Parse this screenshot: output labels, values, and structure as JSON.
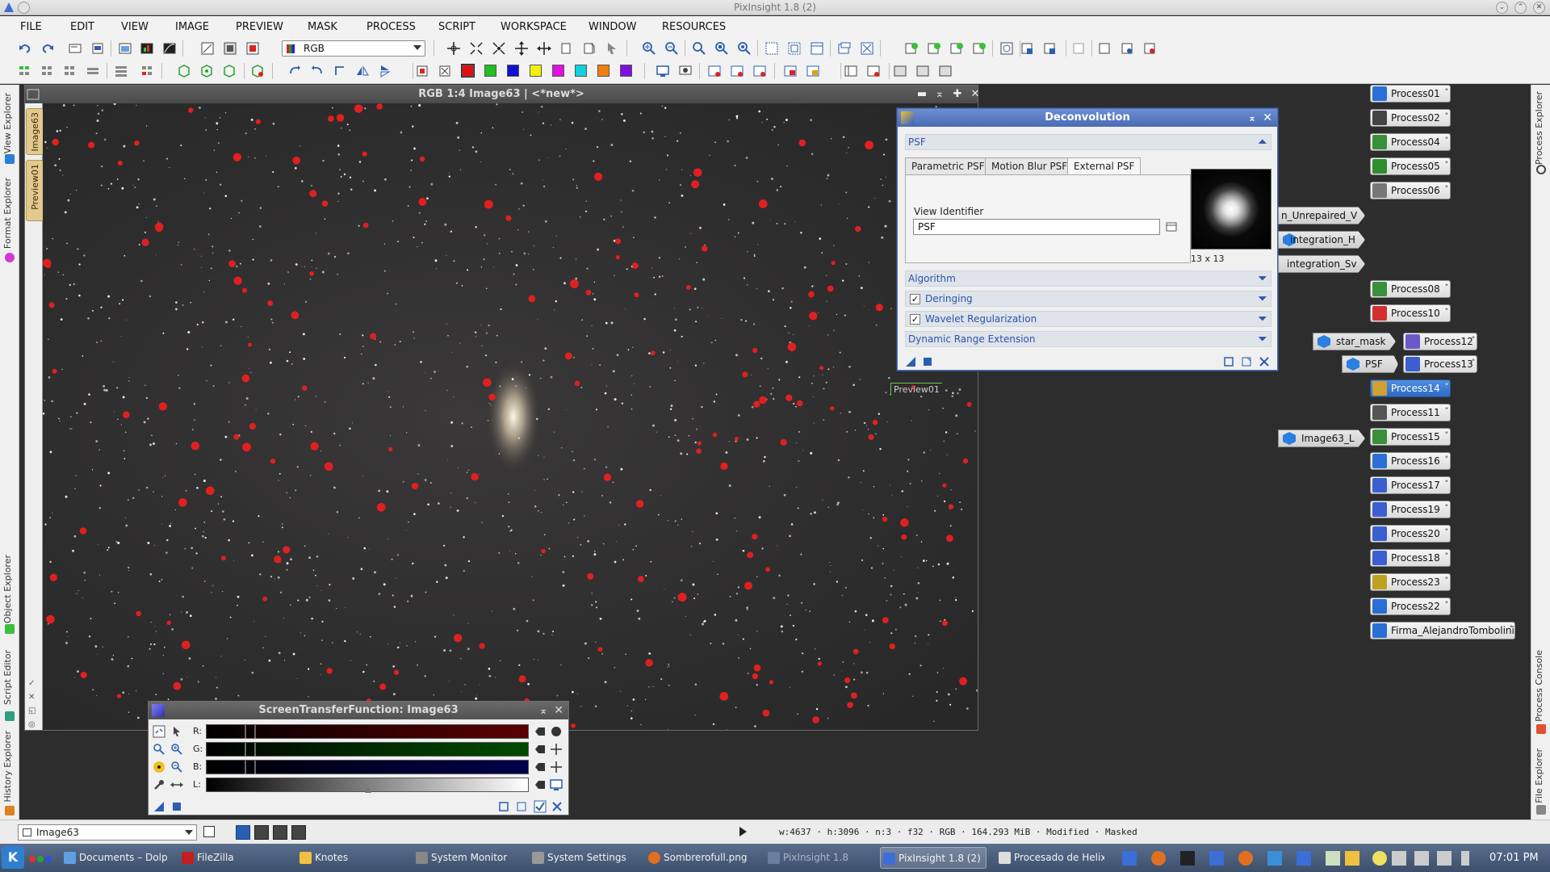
{
  "window": {
    "title": "PixInsight 1.8 (2)"
  },
  "menu": [
    "FILE",
    "EDIT",
    "VIEW",
    "IMAGE",
    "PREVIEW",
    "MASK",
    "PROCESS",
    "SCRIPT",
    "WORKSPACE",
    "WINDOW",
    "RESOURCES"
  ],
  "toolbar": {
    "color_mode": "RGB"
  },
  "left_panels": [
    "View Explorer",
    "Format Explorer",
    "Object Explorer",
    "Script Editor",
    "History Explorer"
  ],
  "right_panels": [
    "Process Explorer",
    "Process Console",
    "File Explorer"
  ],
  "image_tabs": [
    "Image63",
    "Preview01"
  ],
  "image_window": {
    "title": "RGB 1:4 Image63 | <*new*>",
    "preview_label": "Preview01"
  },
  "deconvolution": {
    "title": "Deconvolution",
    "psf_section": "PSF",
    "tabs": [
      "Parametric PSF",
      "Motion Blur PSF",
      "External PSF"
    ],
    "active_tab": "External PSF",
    "view_identifier_label": "View Identifier",
    "view_identifier_value": "PSF",
    "psf_size": "13 x 13",
    "sections": {
      "algorithm": "Algorithm",
      "deringing": "Deringing",
      "wavelet": "Wavelet Regularization",
      "dynamic_range": "Dynamic Range Extension"
    }
  },
  "process_icons": [
    {
      "label": "Process01",
      "color": "#2b6fd6"
    },
    {
      "label": "Process02",
      "color": "#444444"
    },
    {
      "label": "Process04",
      "color": "#3a8f3a"
    },
    {
      "label": "Process05",
      "color": "#2f8f2f"
    },
    {
      "label": "Process06",
      "color": "#777777"
    },
    {
      "label": "Process08",
      "color": "#3a8f3a"
    },
    {
      "label": "Process10",
      "color": "#d23030"
    },
    {
      "label": "Process12",
      "color": "#6a5ac9"
    },
    {
      "label": "Process13",
      "color": "#3b5fd0"
    },
    {
      "label": "Process14",
      "color": "#d0a030"
    },
    {
      "label": "Process11",
      "color": "#555555"
    },
    {
      "label": "Process15",
      "color": "#3a8f3a"
    },
    {
      "label": "Process16",
      "color": "#2b6fd6"
    },
    {
      "label": "Process17",
      "color": "#3b5fd0"
    },
    {
      "label": "Process19",
      "color": "#3b5fd0"
    },
    {
      "label": "Process20",
      "color": "#3b5fd0"
    },
    {
      "label": "Process18",
      "color": "#3b5fd0"
    },
    {
      "label": "Process23",
      "color": "#c0a020"
    },
    {
      "label": "Process22",
      "color": "#2b6fd6"
    },
    {
      "label": "Firma_AlejandroTombolini",
      "color": "#2b6fd6"
    }
  ],
  "view_icons": [
    "n_Unrepaired_V",
    "integration_H",
    "integration_Sv",
    "star_mask",
    "PSF",
    "Image63_L"
  ],
  "stf": {
    "title": "ScreenTransferFunction: Image63",
    "channels": [
      "R:",
      "G:",
      "B:",
      "L:"
    ]
  },
  "status": {
    "view_selector": "Image63",
    "info": "w:4637 · h:3096 · n:3 · f32 · RGB · 164.293 MiB · Modified · Masked"
  },
  "taskbar": {
    "tasks": [
      "Documents – Dolph",
      "FileZilla",
      "Knotes",
      "System Monitor",
      "System Settings",
      "Sombrerofull.png",
      "PixInsight 1.8",
      "PixInsight 1.8 (2)",
      "Procesado de Helix"
    ],
    "clock": "07:01 PM"
  },
  "colors": {
    "accent": "#4a6ab4",
    "selection": "#2f6ac2",
    "star_marker": "#e02020"
  }
}
